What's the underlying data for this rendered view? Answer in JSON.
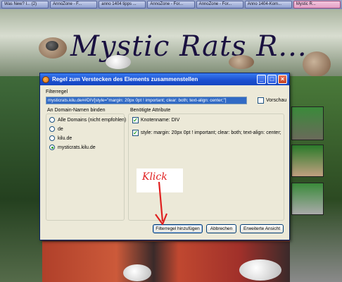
{
  "taskbar": {
    "tasks": [
      {
        "label": "Was New? I... (2)"
      },
      {
        "label": "AnnoZone - F..."
      },
      {
        "label": "anno 1404 tipps ..."
      },
      {
        "label": "AnnoZone - For..."
      },
      {
        "label": "AnnoZone - For..."
      },
      {
        "label": "Anno 1404-Kom..."
      },
      {
        "label": "Mystic R..."
      }
    ]
  },
  "website": {
    "banner_title": "Mystic Rats R..."
  },
  "dialog": {
    "title": "Regel zum Verstecken des Elements zusammenstellen",
    "filter_label": "Filterregel",
    "filter_value": "mysticrats.kilu.de##DIV[style=\"margin: 20px 0pt ! important; clear: both; text-align: center;\"]",
    "preview_label": "Vorschau",
    "domains": {
      "heading": "An Domain-Namen binden",
      "options": [
        {
          "label": "Alle Domains (nicht empfohlen)"
        },
        {
          "label": "de"
        },
        {
          "label": "kilu.de"
        },
        {
          "label": "mysticrats.kilu.de"
        }
      ],
      "selected": "mysticrats.kilu.de"
    },
    "attributes": {
      "heading": "Benötigte Attribute",
      "items": [
        {
          "label": "Knotenname: DIV"
        },
        {
          "label": "style: margin: 20px 0pt ! important; clear: both; text-align: center;"
        }
      ]
    },
    "buttons": {
      "add": "Filterregel hinzufügen",
      "cancel": "Abbrechen",
      "advanced": "Erweiterte Ansicht"
    }
  },
  "annotation": {
    "text": "Klick",
    "color": "#e02020"
  },
  "colors": {
    "titlebar": "#1a4fd0",
    "dialog_bg": "#ece9d8",
    "selection": "#316ac5"
  }
}
